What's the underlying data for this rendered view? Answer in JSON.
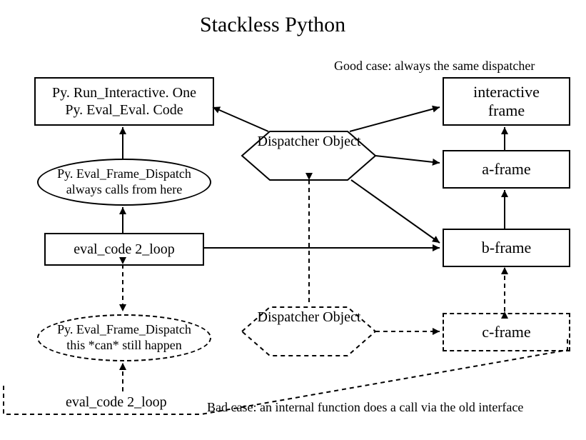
{
  "title": "Stackless Python",
  "notes": {
    "good": "Good case: always the same dispatcher",
    "bad": "Bad case: an internal function does a call via the old interface"
  },
  "boxes": {
    "pyrun": {
      "l1": "Py. Run_Interactive. One",
      "l2": "Py. Eval_Eval. Code"
    },
    "interactive": {
      "l1": "interactive",
      "l2": "frame"
    },
    "aframe": "a-frame",
    "bframe": "b-frame",
    "cframe": "c-frame",
    "eval1": "eval_code 2_loop",
    "eval2": "eval_code 2_loop"
  },
  "ellipses": {
    "disp1": {
      "l1": "Py. Eval_Frame_Dispatch",
      "l2": "always calls from here"
    },
    "disp2": {
      "l1": "Py. Eval_Frame_Dispatch",
      "l2": "this *can* still happen"
    }
  },
  "hexlabels": {
    "obj1": "Dispatcher Object",
    "obj2": "Dispatcher Object"
  }
}
